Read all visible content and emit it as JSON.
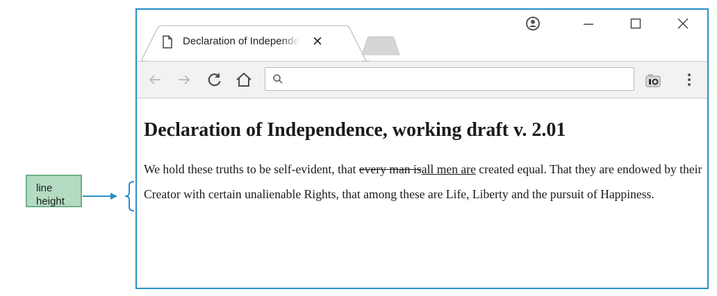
{
  "callout": {
    "line1": "line",
    "line2": "height"
  },
  "colors": {
    "window_border": "#2a90c6",
    "callout_fill": "#b4dbc1",
    "callout_border": "#6fae85"
  },
  "browser": {
    "tab": {
      "title": "Declaration of Independence"
    },
    "omnibox": {
      "value": "",
      "placeholder": ""
    },
    "icons": [
      "page-icon",
      "tab-close-icon",
      "profile-icon",
      "minimize-icon",
      "maximize-icon",
      "window-close-icon",
      "back-arrow-icon",
      "forward-arrow-icon",
      "reload-icon",
      "home-icon",
      "search-icon",
      "extension-icon",
      "menu-icon"
    ]
  },
  "page": {
    "heading": "Declaration of Independence, working draft v. 2.01",
    "para": {
      "text1": "We hold these truths to be self-evident, that ",
      "deleted": "every man is",
      "inserted": "all men are",
      "text2": " created equal. That they are endowed by their Creator with certain unalienable Rights, that among these are Life, Liberty and the pursuit of Happiness."
    }
  }
}
